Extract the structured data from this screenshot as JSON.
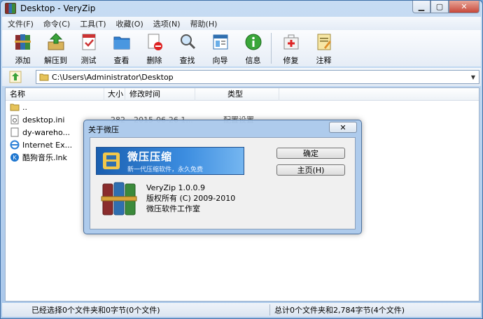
{
  "window": {
    "title": "Desktop - VeryZip"
  },
  "menu": [
    "文件(F)",
    "命令(C)",
    "工具(T)",
    "收藏(O)",
    "选项(N)",
    "帮助(H)"
  ],
  "toolbar": [
    "添加",
    "解压到",
    "测试",
    "查看",
    "删除",
    "查找",
    "向导",
    "信息",
    "修复",
    "注释"
  ],
  "address": {
    "path": "C:\\Users\\Administrator\\Desktop"
  },
  "columns": {
    "name": "名称",
    "size": "大小",
    "date": "修改时间",
    "type": "类型"
  },
  "files": [
    {
      "name": "..",
      "size": "",
      "date": "",
      "type": ""
    },
    {
      "name": "desktop.ini",
      "size": "282",
      "date": "2015-06-26 1...",
      "type": "配置设置"
    },
    {
      "name": "dy-wareho...",
      "size": "",
      "date": "",
      "type": ""
    },
    {
      "name": "Internet Ex...",
      "size": "",
      "date": "",
      "type": ""
    },
    {
      "name": "酷狗音乐.lnk",
      "size": "",
      "date": "",
      "type": ""
    }
  ],
  "status": {
    "left": "已经选择0个文件夹和0字节(0个文件)",
    "right": "总计0个文件夹和2,784字节(4个文件)"
  },
  "dialog": {
    "title": "关于微压",
    "close": "✕",
    "banner_title": "微压压缩",
    "banner_subtitle": "新一代压缩软件，永久免费",
    "ok": "确定",
    "homepage": "主页(H)",
    "version": "VeryZip 1.0.0.9",
    "copyright": "版权所有 (C) 2009-2010",
    "studio": "微压软件工作室"
  },
  "colors": {
    "accent": "#1a5fb0",
    "title_gradient_top": "#c7dcf3"
  }
}
